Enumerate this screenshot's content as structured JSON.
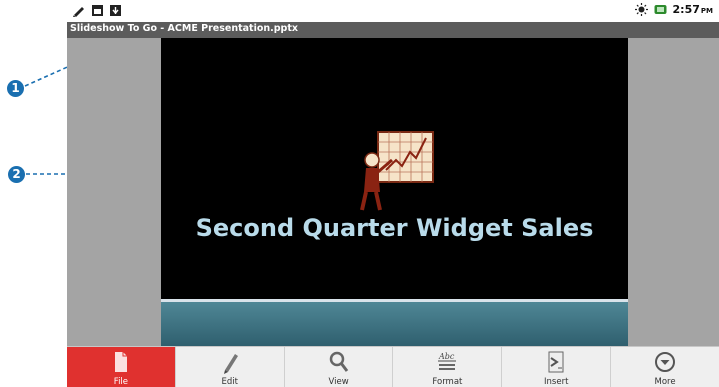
{
  "status_bar": {
    "time": "2:57",
    "ampm": "PM"
  },
  "title_bar": {
    "app_title": "Slideshow To Go - ACME Presentation.pptx"
  },
  "slide": {
    "title": "Second Quarter Widget Sales"
  },
  "toolbar": {
    "items": [
      {
        "label": "File",
        "icon": "file-icon",
        "active": true
      },
      {
        "label": "Edit",
        "icon": "pencil-icon",
        "active": false
      },
      {
        "label": "View",
        "icon": "magnifier-icon",
        "active": false
      },
      {
        "label": "Format",
        "icon": "format-icon",
        "active": false
      },
      {
        "label": "Insert",
        "icon": "insert-icon",
        "active": false
      },
      {
        "label": "More",
        "icon": "more-icon",
        "active": false
      }
    ]
  },
  "callouts": {
    "one": "1",
    "two": "2"
  },
  "colors": {
    "accent_active": "#e0312f",
    "callout": "#1a6fb0",
    "title_text": "#b9dbea"
  }
}
